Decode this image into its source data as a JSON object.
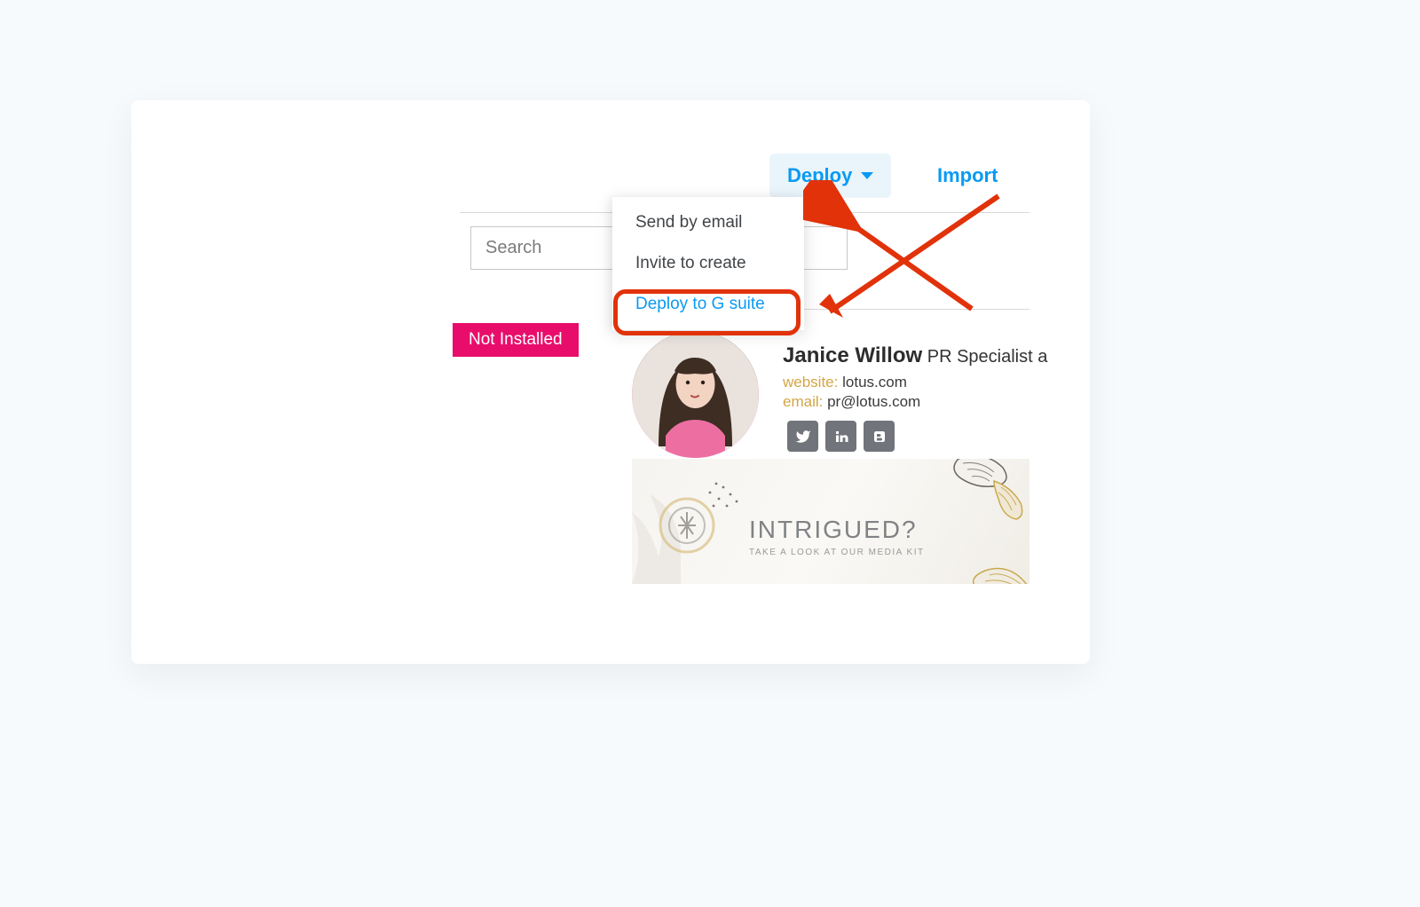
{
  "toolbar": {
    "deploy_label": "Deploy",
    "import_label": "Import"
  },
  "search": {
    "placeholder": "Search"
  },
  "dropdown": {
    "items": [
      {
        "label": "Send by email"
      },
      {
        "label": "Invite to create"
      },
      {
        "label": "Deploy to G suite"
      }
    ]
  },
  "badge": {
    "text": "Not Installed"
  },
  "profile": {
    "name": "Janice Willow",
    "title_fragment": "PR Specialist a",
    "website_label": "website:",
    "website_value": "lotus.com",
    "email_label": "email:",
    "email_value": "pr@lotus.com"
  },
  "banner": {
    "title": "INTRIGUED?",
    "subtitle": "TAKE A LOOK AT OUR MEDIA KIT"
  },
  "social": {
    "twitter": "twitter-icon",
    "linkedin": "linkedin-icon",
    "blogger": "blogger-icon"
  }
}
